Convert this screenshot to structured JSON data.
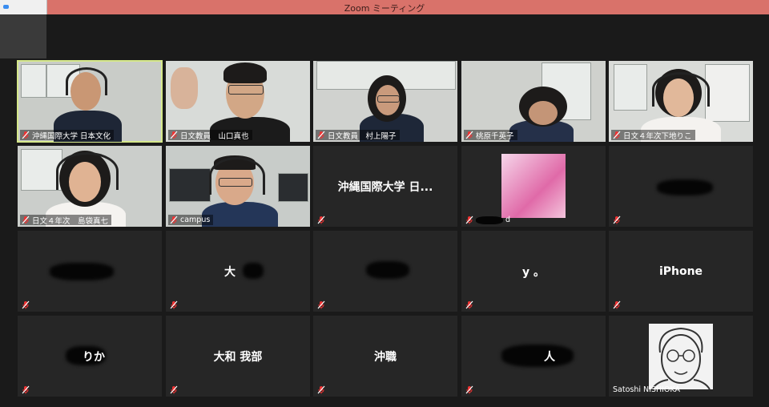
{
  "window": {
    "title": "Zoom ミーティング"
  },
  "colors": {
    "titlebar": "#d9726a",
    "active_border": "#d5e88a",
    "tile_bg": "#262626"
  },
  "participants": [
    {
      "name": "沖縄国際大学 日本文化",
      "video": true
    },
    {
      "name": "日文教員　山口真也",
      "video": true
    },
    {
      "name": "日文教員　村上陽子",
      "video": true
    },
    {
      "name": "桃原千英子",
      "video": true
    },
    {
      "name": "日文４年次下地りこ",
      "video": true
    },
    {
      "name": "日文４年次　島袋真七",
      "video": true
    },
    {
      "name": "campus",
      "video": true
    },
    {
      "name": "沖縄国際大学 日...",
      "video": false
    },
    {
      "name": "d",
      "video": false
    },
    {
      "name": "",
      "video": false
    },
    {
      "name": "",
      "video": false
    },
    {
      "name": "大",
      "video": false
    },
    {
      "name": "",
      "video": false
    },
    {
      "name": "y 。",
      "video": false
    },
    {
      "name": "iPhone",
      "video": false
    },
    {
      "name": "りか",
      "video": false
    },
    {
      "name": "大和 我部",
      "video": false
    },
    {
      "name": "沖職",
      "video": false
    },
    {
      "name": "人",
      "video": false
    },
    {
      "name": "Satoshi NISHIOKA",
      "video": false
    }
  ]
}
